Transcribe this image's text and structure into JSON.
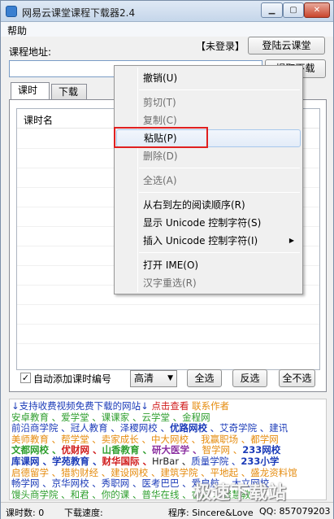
{
  "window": {
    "title": "网易云课堂课程下载器2.4"
  },
  "menubar": {
    "help": "帮助"
  },
  "login": {
    "url_label": "课程地址:",
    "status": "【未登录】",
    "login_button": "登陆云课堂"
  },
  "url": {
    "value": "",
    "fetch_button": "提取下载"
  },
  "tabs": [
    {
      "label": "课时"
    },
    {
      "label": "下载"
    }
  ],
  "list": {
    "column_name": "课时名"
  },
  "controls": {
    "auto_number_label": "自动添加课时编号",
    "auto_number_checked": true,
    "quality": "高清",
    "select_all": "全选",
    "invert": "反选",
    "select_none": "全不选"
  },
  "ads": [
    [
      {
        "t": "↓支持收费视频免费下载的网站↓ ",
        "c": "b"
      },
      {
        "t": "点击查看 ",
        "c": "r"
      },
      {
        "t": "联系作者",
        "c": "o"
      }
    ],
    [
      {
        "t": "安卓教育 、爱学堂 、课课家 、云学堂 、金程网",
        "c": "g"
      }
    ],
    [
      {
        "t": "前沿商学院 、冠人教育 、泽稷网校 、",
        "c": "b"
      },
      {
        "t": "优路网校",
        "c": "b",
        "w": 1
      },
      {
        "t": " 、艾奇学院 、建讯",
        "c": "b"
      }
    ],
    [
      {
        "t": "美师教育 、帮学堂 、卖家成长 、中大网校 、",
        "c": "o"
      },
      {
        "t": "我赢职场 、都学网",
        "c": "o"
      }
    ],
    [
      {
        "t": "文都网校 、",
        "c": "g",
        "w": 1
      },
      {
        "t": "优财网 、",
        "c": "r",
        "w": 1
      },
      {
        "t": "山香教育 、",
        "c": "g",
        "w": 1
      },
      {
        "t": "研大医学 、",
        "c": "p",
        "w": 1
      },
      {
        "t": "智学网 、",
        "c": "o"
      },
      {
        "t": "233网校",
        "c": "b",
        "w": 1
      }
    ],
    [
      {
        "t": "库课网 、学苑教育 、",
        "c": "b",
        "w": 1
      },
      {
        "t": "财华国际 、",
        "c": "r",
        "w": 1
      },
      {
        "t": "HrBar 、",
        "c": "k"
      },
      {
        "t": "质量学院 、",
        "c": "b"
      },
      {
        "t": "233小学",
        "c": "b",
        "w": 1
      }
    ],
    [
      {
        "t": "启德留学 、猎豹财经 、建设网校 、建筑学院 、平地起 、盛龙资料馆",
        "c": "o"
      }
    ],
    [
      {
        "t": "畅学网 、京华网校 、秀职网 、医考巴巴 、爱启航 、大立网校",
        "c": "b"
      }
    ],
    [
      {
        "t": "馒头商学院 、和君 、你的课 、普华在线 、睿云 、聚慧教育",
        "c": "g"
      }
    ]
  ],
  "status": {
    "count": "课时数: 0",
    "speed": "下载速度:",
    "program": "程序: Sincere&Love",
    "qq": "QQ: 857079203"
  },
  "context_menu": [
    {
      "label": "撤销(U)",
      "enabled": true
    },
    {
      "sep": true
    },
    {
      "label": "剪切(T)",
      "enabled": false
    },
    {
      "label": "复制(C)",
      "enabled": false
    },
    {
      "label": "粘贴(P)",
      "enabled": true,
      "highlighted": true
    },
    {
      "label": "删除(D)",
      "enabled": false
    },
    {
      "sep": true
    },
    {
      "label": "全选(A)",
      "enabled": false
    },
    {
      "sep": true
    },
    {
      "label": "从右到左的阅读顺序(R)",
      "enabled": true
    },
    {
      "label": "显示 Unicode 控制字符(S)",
      "enabled": true
    },
    {
      "label": "插入 Unicode 控制字符(I)",
      "enabled": true,
      "submenu": true
    },
    {
      "sep": true
    },
    {
      "label": "打开 IME(O)",
      "enabled": true
    },
    {
      "label": "汉字重选(R)",
      "enabled": false
    }
  ],
  "watermark": "极速下载站"
}
